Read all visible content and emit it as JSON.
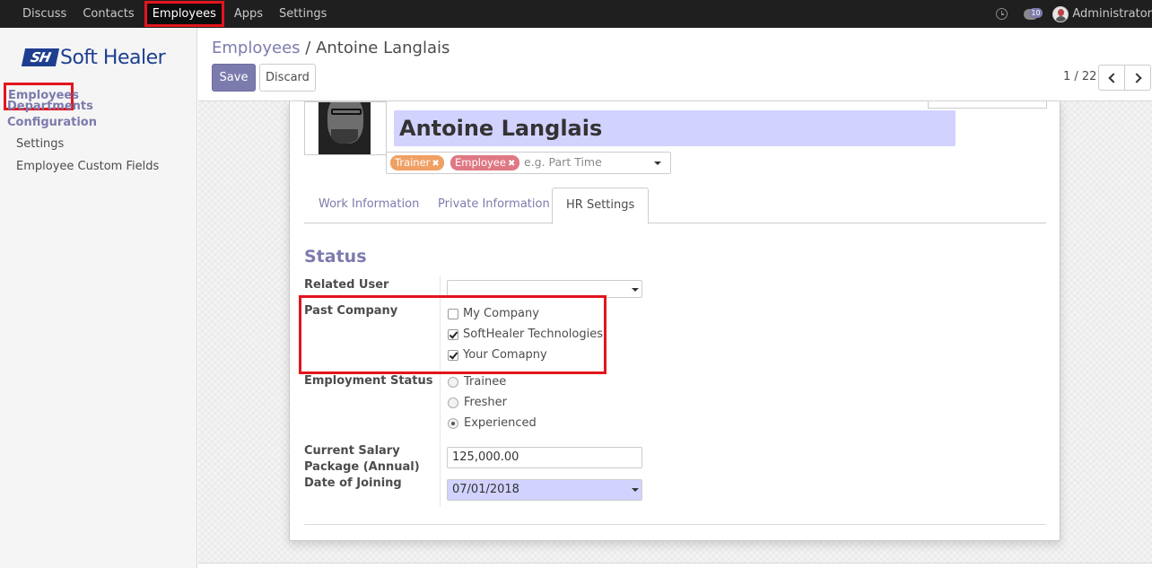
{
  "topnav": {
    "items": [
      "Discuss",
      "Contacts",
      "Employees",
      "Apps",
      "Settings"
    ],
    "active_index": 2,
    "chat_count": "10",
    "user_name": "Administrator"
  },
  "sidebar": {
    "logo_mark": "SH",
    "logo_text": "Soft Healer",
    "main_items": [
      "Employees",
      "Departments",
      "Configuration"
    ],
    "sub_items": [
      "Settings",
      "Employee Custom Fields"
    ]
  },
  "control": {
    "breadcrumb_parent": "Employees",
    "breadcrumb_sep": "/",
    "breadcrumb_current": "Antoine Langlais",
    "save_label": "Save",
    "discard_label": "Discard",
    "pager": "1 / 22"
  },
  "form": {
    "name": "Antoine Langlais",
    "tags": [
      "Trainer",
      "Employee"
    ],
    "tags_placeholder": "e.g. Part Time",
    "tabs": [
      "Work Information",
      "Private Information",
      "HR Settings"
    ],
    "active_tab": 2,
    "section_title": "Status",
    "labels": {
      "related_user": "Related User",
      "past_company": "Past Company",
      "employment_status": "Employment Status",
      "salary": "Current Salary Package (Annual)",
      "date_joining": "Date of Joining"
    },
    "related_user_value": "",
    "past_companies": [
      {
        "label": "My Company",
        "checked": false
      },
      {
        "label": "SoftHealer Technologies",
        "checked": true
      },
      {
        "label": "Your Comapny",
        "checked": true
      }
    ],
    "employment_statuses": [
      {
        "label": "Trainee",
        "selected": false
      },
      {
        "label": "Fresher",
        "selected": false
      },
      {
        "label": "Experienced",
        "selected": true
      }
    ],
    "salary_value": "125,000.00",
    "date_joining_value": "07/01/2018"
  },
  "colors": {
    "accent": "#7c7bad",
    "highlight_red": "#e3151d",
    "required_field_bg": "#d2d2ff",
    "tag_trainer": "#f0a064",
    "tag_employee": "#e07884",
    "brand_blue": "#1e3f8f"
  }
}
